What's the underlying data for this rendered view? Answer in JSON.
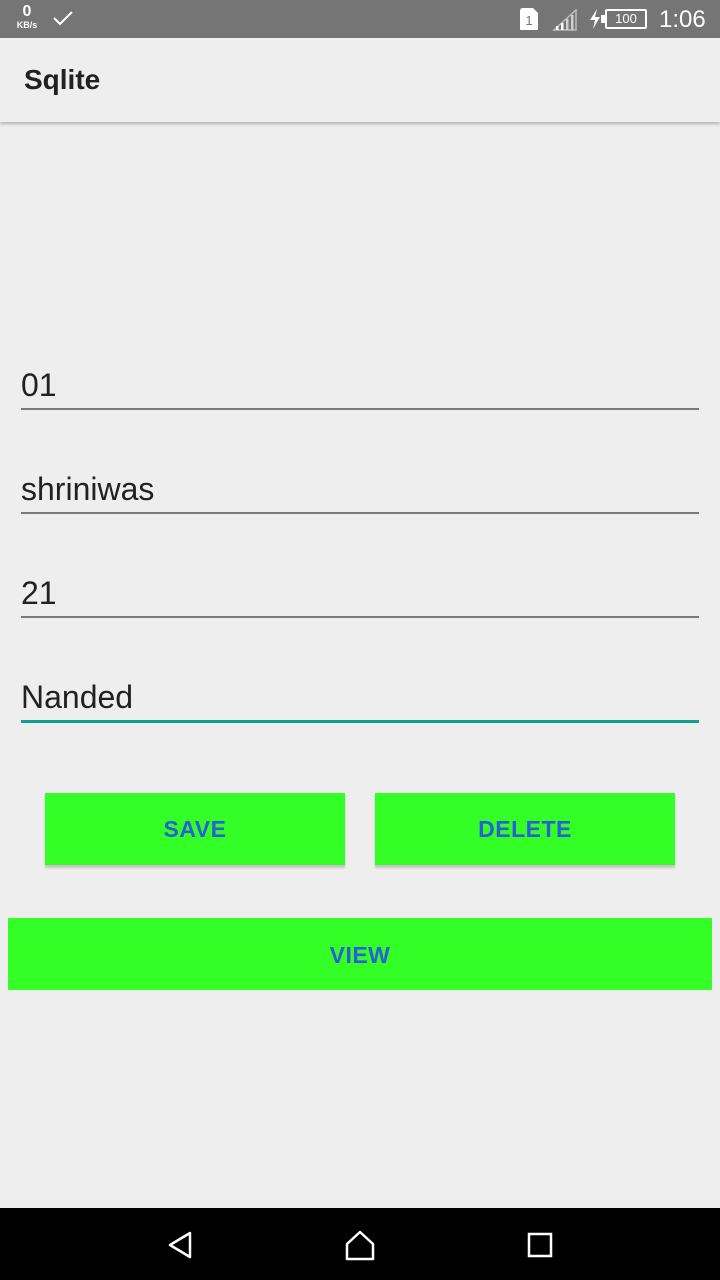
{
  "status_bar": {
    "net_speed_value": "0",
    "net_speed_unit": "KB/s",
    "sim_slot": "1",
    "battery": "100",
    "time": "1:06",
    "icons": [
      "check-icon",
      "sim-icon",
      "signal-icon",
      "charging-icon",
      "battery-icon"
    ]
  },
  "app_bar": {
    "title": "Sqlite"
  },
  "form": {
    "fields": [
      {
        "value": "01",
        "focused": false
      },
      {
        "value": "shriniwas",
        "focused": false
      },
      {
        "value": "21",
        "focused": false
      },
      {
        "value": "Nanded",
        "focused": true
      }
    ]
  },
  "buttons": {
    "save": "SAVE",
    "delete": "DELETE",
    "view": "VIEW"
  },
  "colors": {
    "button_bg": "#33ff26",
    "button_text": "#2a5fd8",
    "focus_underline": "#139c91",
    "status_bar": "#757575"
  },
  "nav_bar": {
    "icons": [
      "back-icon",
      "home-icon",
      "recent-apps-icon"
    ]
  }
}
